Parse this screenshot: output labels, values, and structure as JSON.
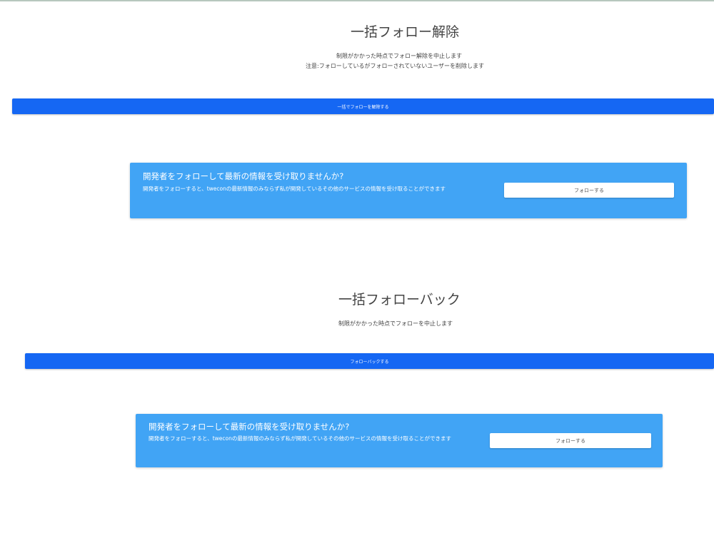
{
  "colors": {
    "primary_button": "#1567f3",
    "promo_background": "#41a4f5",
    "promo_button": "#ffffff",
    "text": "#444444"
  },
  "unfollow": {
    "title": "一括フォロー解除",
    "desc_line1": "制限がかかった時点でフォロー解除を中止します",
    "desc_line2": "注意:フォローしているがフォローされていないユーザーを削除します",
    "button_label": "一括でフォローを解除する"
  },
  "promo1": {
    "title": "開発者をフォローして最新の情報を受け取りませんか?",
    "text": "開発者をフォローすると、tweconの最新情報のみならず私が開発しているその他のサービスの情報を受け取ることができます",
    "button_label": "フォローする"
  },
  "followback": {
    "title": "一括フォローバック",
    "desc": "制限がかかった時点でフォローを中止します",
    "button_label": "フォローバックする"
  },
  "promo2": {
    "title": "開発者をフォローして最新の情報を受け取りませんか?",
    "text": "開発者をフォローすると、tweconの最新情報のみならず私が開発しているその他のサービスの情報を受け取ることができます",
    "button_label": "フォローする"
  }
}
